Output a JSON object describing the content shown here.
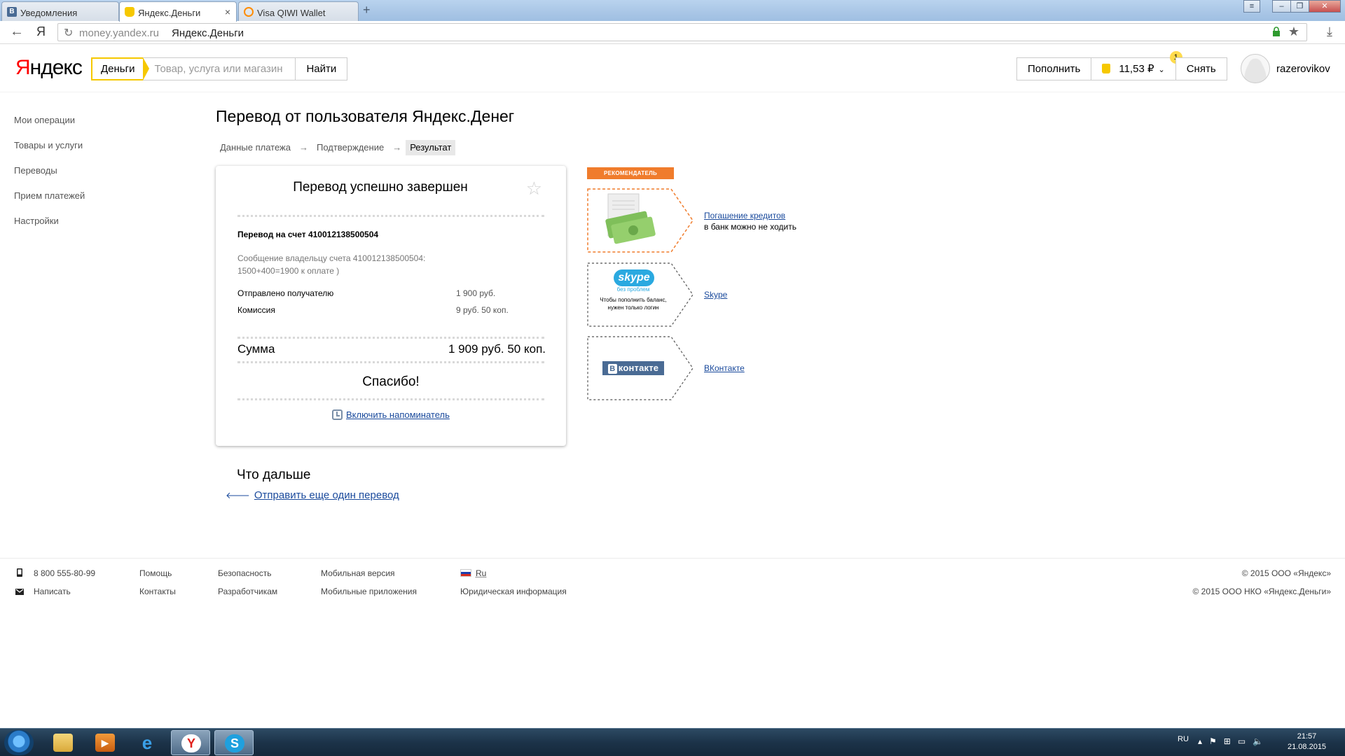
{
  "browser": {
    "tabs": [
      {
        "label": "Уведомления",
        "favicon": "vk-icon",
        "color": "#4a6b94",
        "glyph": "В"
      },
      {
        "label": "Яндекс.Деньги",
        "favicon": "yandex-money-icon",
        "color": "#f6c800",
        "glyph": ""
      },
      {
        "label": "Visa QIWI Wallet",
        "favicon": "qiwi-icon",
        "color": "#ff8c00",
        "glyph": ""
      }
    ],
    "new_tab": "+",
    "nav_ya": "Я",
    "url_domain": "money.yandex.ru",
    "url_title": "Яндекс.Деньги"
  },
  "header": {
    "logo_first": "Я",
    "logo_rest": "ндекс",
    "service_tag": "Деньги",
    "search_placeholder": "Товар, услуга или магазин",
    "find_button": "Найти",
    "topup_button": "Пополнить",
    "balance": "11,53 ₽",
    "badge_count": "1",
    "withdraw_button": "Снять",
    "username": "razerovikov"
  },
  "sidebar": {
    "items": [
      "Мои операции",
      "Товары и услуги",
      "Переводы",
      "Прием платежей",
      "Настройки"
    ]
  },
  "main": {
    "title": "Перевод от пользователя Яндекс.Денег",
    "steps": [
      "Данные платежа",
      "Подтверждение",
      "Результат"
    ],
    "step_arrow": "→",
    "receipt": {
      "title": "Перевод успешно завершен",
      "account_line": "Перевод на счет 410012138500504",
      "message_line1": "Сообщение владельцу счета 410012138500504:",
      "message_line2": "1500+400=1900 к оплате )",
      "sent_label": "Отправлено получателю",
      "sent_value": "1 900 руб.",
      "fee_label": "Комиссия",
      "fee_value": "9 руб. 50 коп.",
      "sum_label": "Сумма",
      "sum_value": "1 909 руб. 50 коп.",
      "thanks": "Спасибо!",
      "reminder_link": "Включить напоминатель"
    },
    "next_title": "Что дальше",
    "next_link": "Отправить еще один перевод"
  },
  "recommendations": {
    "label": "РЕКОМЕНДАТЕЛЬ",
    "items": [
      {
        "link": "Погашение кредитов",
        "text": "в банк можно не ходить"
      },
      {
        "link": "Skype",
        "text": ""
      },
      {
        "link": "ВКонтакте",
        "text": ""
      }
    ],
    "skype_logo": "skype",
    "skype_sub": "без проблем",
    "skype_desc": "Чтобы пополнить баланс, нужен только логин",
    "vk_logo_b": "В",
    "vk_logo_rest": "контакте"
  },
  "footer": {
    "phone": "8 800 555-80-99",
    "write": "Написать",
    "help": "Помощь",
    "contacts": "Контакты",
    "security": "Безопасность",
    "developers": "Разработчикам",
    "mobile_version": "Мобильная версия",
    "mobile_apps": "Мобильные приложения",
    "lang": "Ru",
    "legal": "Юридическая информация",
    "copyright1": "© 2015 ООО «Яндекс»",
    "copyright2": "© 2015 ООО НКО «Яндекс.Деньги»"
  },
  "taskbar": {
    "lang": "RU",
    "time": "21:57",
    "date": "21.08.2015"
  },
  "colors": {
    "brand_yellow": "#f6c800",
    "recommend_orange": "#f07c2c",
    "link_blue": "#1a4a9c"
  }
}
